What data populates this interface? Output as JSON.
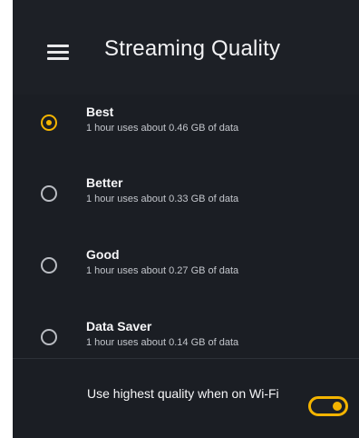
{
  "header": {
    "title": "Streaming Quality",
    "menu_icon": "hamburger-menu-icon"
  },
  "options": [
    {
      "label": "Best",
      "description": "1 hour uses about 0.46 GB of data",
      "selected": true
    },
    {
      "label": "Better",
      "description": "1 hour uses about 0.33 GB of data",
      "selected": false
    },
    {
      "label": "Good",
      "description": "1 hour uses about 0.27 GB of data",
      "selected": false
    },
    {
      "label": "Data Saver",
      "description": "1 hour uses about 0.14 GB of data",
      "selected": false
    }
  ],
  "wifi_setting": {
    "label": "Use highest quality when on Wi-Fi",
    "enabled": true
  },
  "colors": {
    "background": "#1b1e24",
    "accent": "#f4b400",
    "text": "#f6f6f8",
    "muted_text": "#c3c6cc"
  }
}
